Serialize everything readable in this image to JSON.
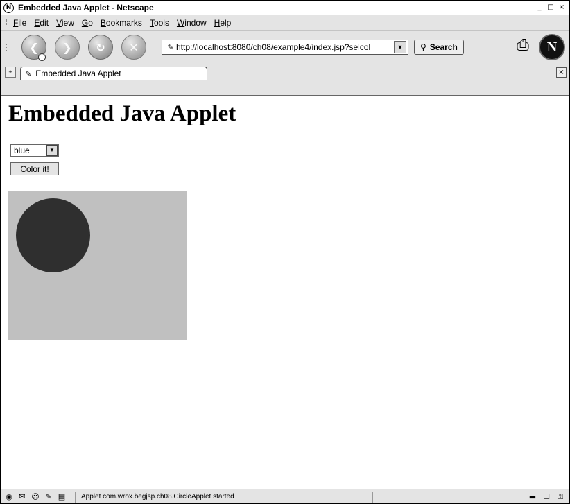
{
  "window": {
    "title": "Embedded Java Applet - Netscape",
    "minimize": "_",
    "maximize": "□",
    "close": "×"
  },
  "menu": [
    "File",
    "Edit",
    "View",
    "Go",
    "Bookmarks",
    "Tools",
    "Window",
    "Help"
  ],
  "nav": {
    "url": "http://localhost:8080/ch08/example4/index.jsp?selcol",
    "search_label": "Search"
  },
  "tabs": [
    {
      "label": "Embedded Java Applet"
    }
  ],
  "page": {
    "heading": "Embedded Java Applet",
    "select_value": "blue",
    "button_label": "Color it!"
  },
  "applet": {
    "background": "#c0c0c0",
    "circle_color": "#2f2f2f"
  },
  "status": {
    "text": "Applet com.wrox.begjsp.ch08.CircleApplet started"
  }
}
